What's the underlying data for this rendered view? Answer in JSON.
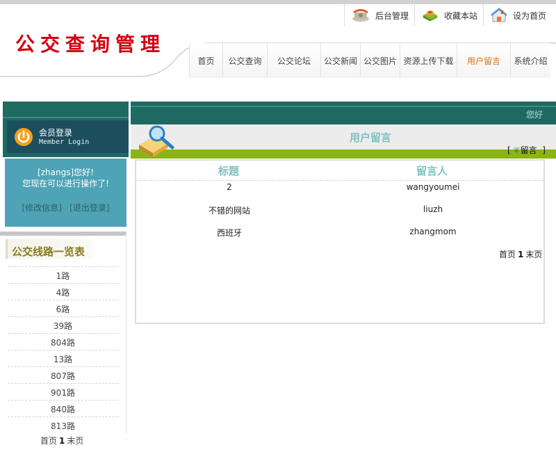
{
  "top_links": [
    {
      "label": "后台管理",
      "icon": "phone-icon"
    },
    {
      "label": "收藏本站",
      "icon": "favorite-box-icon"
    },
    {
      "label": "设为首页",
      "icon": "house-icon"
    }
  ],
  "site_title": "公交查询管理",
  "nav": [
    {
      "label": "首页",
      "active": false
    },
    {
      "label": "公交查询",
      "active": false
    },
    {
      "label": "公交论坛",
      "active": false
    },
    {
      "label": "公交新闻",
      "active": false
    },
    {
      "label": "公交图片",
      "active": false
    },
    {
      "label": "资源上传下载",
      "active": false
    },
    {
      "label": "用户留言",
      "active": true
    },
    {
      "label": "系统介绍",
      "active": false
    }
  ],
  "sidebar": {
    "login_title": "会员登录",
    "login_subtitle": "Member Login",
    "greeting_line1": "[zhangs]您好!",
    "greeting_line2": "您现在可以进行操作了!",
    "edit_info": "[修改信息]",
    "logout": "[退出登录]",
    "routes_title": "公交线路一览表",
    "routes": [
      "1路",
      "4路",
      "6路",
      "39路",
      "804路",
      "13路",
      "807路",
      "901路",
      "840路",
      "813路"
    ],
    "pager": {
      "first": "首页",
      "current": "1",
      "last": "末页"
    }
  },
  "main": {
    "hello": "您好",
    "section_title": "用户留言",
    "post_link": "留言",
    "columns": [
      "标题",
      "留言人"
    ],
    "rows": [
      {
        "title": "2",
        "author": "wangyoumei"
      },
      {
        "title": "不错的网站",
        "author": "liuzh"
      },
      {
        "title": "西班牙",
        "author": "zhangmom"
      }
    ],
    "pager": {
      "first": "首页",
      "current": "1",
      "last": "末页"
    }
  },
  "colors": {
    "brand_red": "#d4000f",
    "header_teal": "#1e6a63",
    "login_bg": "#4fa3b6",
    "accent_green": "#8ab514",
    "active_nav": "#e46c0a",
    "table_header": "#7ec2c0"
  }
}
